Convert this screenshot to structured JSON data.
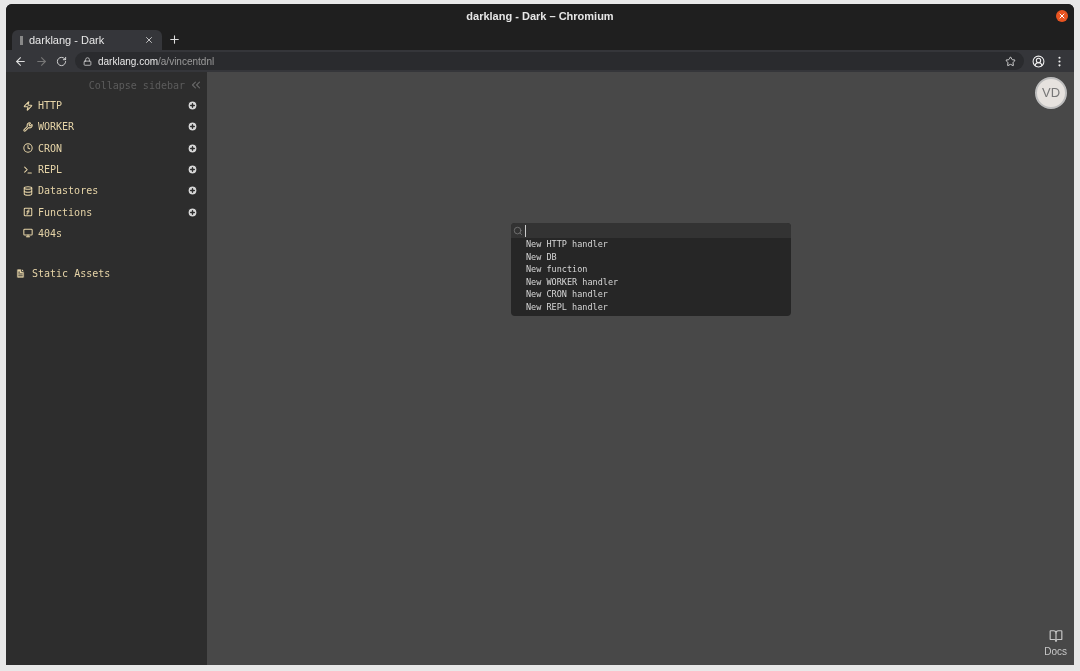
{
  "window": {
    "title": "darklang - Dark – Chromium"
  },
  "tabs": [
    {
      "label": "darklang - Dark",
      "selected": true
    }
  ],
  "address_bar": {
    "host": "darklang.com",
    "path": "/a/vincentdnl"
  },
  "sidebar": {
    "collapse_label": "Collapse sidebar",
    "items": [
      {
        "kind": "http",
        "label": "HTTP",
        "addable": true
      },
      {
        "kind": "worker",
        "label": "WORKER",
        "addable": true
      },
      {
        "kind": "cron",
        "label": "CRON",
        "addable": true
      },
      {
        "kind": "repl",
        "label": "REPL",
        "addable": true
      },
      {
        "kind": "datastores",
        "label": "Datastores",
        "addable": true
      },
      {
        "kind": "functions",
        "label": "Functions",
        "addable": true
      },
      {
        "kind": "notfound",
        "label": "404s",
        "addable": false
      }
    ],
    "static_assets": "Static Assets"
  },
  "avatar": "VD",
  "omnibox": {
    "options": [
      "New HTTP handler",
      "New DB",
      "New function",
      "New WORKER handler",
      "New CRON handler",
      "New REPL handler"
    ]
  },
  "docs": "Docs"
}
